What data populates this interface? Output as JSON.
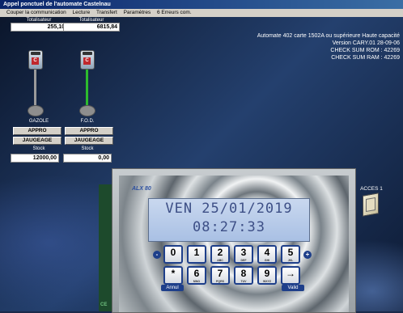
{
  "window": {
    "title": "Appel ponctuel de l'automate Castelnau"
  },
  "menu": [
    "Couper la communication",
    "Lecture",
    "Transfert",
    "Paramètres",
    "6 Erreurs com."
  ],
  "tanks": [
    {
      "totaliser_label": "Totalisateur",
      "totaliser_value": "255,10",
      "name": "GAZOLE",
      "btn1": "APPRO",
      "btn2": "JAUGEAGE",
      "stock_label": "Stock",
      "stock_value": "12000,00",
      "pipe_color": "#9a9a9a"
    },
    {
      "totaliser_label": "Totalisateur",
      "totaliser_value": "6815,84",
      "name": "F.O.D.",
      "btn1": "APPRO",
      "btn2": "JAUGEAGE",
      "stock_label": "Stock",
      "stock_value": "0,00",
      "pipe_color": "#2dbb2d"
    }
  ],
  "info": [
    "Automate 402 carte 1502A ou supérieure Haute capacité",
    "Version  CARY.01 28-09-06",
    "CHECK SUM ROM : 42269",
    "CHECK SUM RAM : 42269"
  ],
  "device": {
    "brand": "ALX 80",
    "lcd_line1": "VEN 25/01/2019",
    "lcd_line2": "08:27:33",
    "row1": [
      {
        "main": "0",
        "sub": ""
      },
      {
        "main": "1",
        "sub": ""
      },
      {
        "main": "2",
        "sub": "ABC"
      },
      {
        "main": "3",
        "sub": "DEF"
      },
      {
        "main": "4",
        "sub": "GHI"
      },
      {
        "main": "5",
        "sub": "JKL"
      }
    ],
    "row2": [
      {
        "main": "*",
        "sub": ""
      },
      {
        "main": "6",
        "sub": "MNO"
      },
      {
        "main": "7",
        "sub": "PQRS"
      },
      {
        "main": "8",
        "sub": "TUV"
      },
      {
        "main": "9",
        "sub": "WXYZ"
      },
      {
        "main": "→",
        "sub": ""
      }
    ],
    "minus": "-",
    "plus": "+",
    "cancel": "Annul",
    "valid": "Valid"
  },
  "acces": {
    "label": "ACCES 1"
  },
  "green_tab": "CE"
}
